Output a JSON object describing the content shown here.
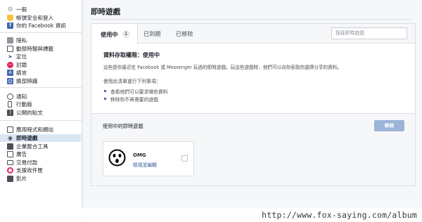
{
  "sidebar": {
    "groups": [
      {
        "items": [
          {
            "label": "一般",
            "icon": "gear-icon",
            "color": "#90949c"
          },
          {
            "label": "帳號安全和登入",
            "icon": "shield-icon",
            "color": "#f5c33b"
          },
          {
            "label": "你的 Facebook 資訊",
            "icon": "facebook-icon",
            "color": "#4267b2"
          }
        ]
      },
      {
        "items": [
          {
            "label": "隱私",
            "icon": "lock-icon",
            "color": "#90949c"
          },
          {
            "label": "動態時報與標籤",
            "icon": "timeline-icon",
            "color": "#4b4f56"
          },
          {
            "label": "定位",
            "icon": "location-icon",
            "color": "#4267b2"
          },
          {
            "label": "封鎖",
            "icon": "block-icon",
            "color": "#e0245e"
          },
          {
            "label": "語言",
            "icon": "language-icon",
            "color": "#4267b2"
          },
          {
            "label": "臉部辨識",
            "icon": "face-recognition-icon",
            "color": "#4267b2"
          }
        ]
      },
      {
        "items": [
          {
            "label": "通知",
            "icon": "globe-icon",
            "color": "#4b4f56"
          },
          {
            "label": "行動版",
            "icon": "mobile-icon",
            "color": "#4b4f56"
          },
          {
            "label": "公開的貼文",
            "icon": "rss-icon",
            "color": "#4b4f56"
          }
        ]
      },
      {
        "items": [
          {
            "label": "應用程式和網站",
            "icon": "apps-icon",
            "color": "#4b4f56"
          },
          {
            "label": "即時遊戲",
            "icon": "game-controller-icon",
            "color": "#4b4f56",
            "active": true
          },
          {
            "label": "企業整合工具",
            "icon": "business-icon",
            "color": "#4b4f56"
          },
          {
            "label": "廣告",
            "icon": "ads-icon",
            "color": "#4b4f56"
          },
          {
            "label": "交易付款",
            "icon": "payments-icon",
            "color": "#4b4f56"
          },
          {
            "label": "支援收件匣",
            "icon": "support-icon",
            "color": "#e0245e"
          },
          {
            "label": "影片",
            "icon": "video-icon",
            "color": "#4b4f56"
          }
        ]
      }
    ]
  },
  "main": {
    "title": "即時遊戲",
    "tabs": [
      {
        "label": "使用中",
        "count": "1"
      },
      {
        "label": "已到期"
      },
      {
        "label": "已移除"
      }
    ],
    "search_placeholder": "搜尋即時遊戲",
    "access_heading": "資料存取權限：使用中",
    "description": "這些是你最近在 Facebook 或 Messenger 玩過的即時遊戲。玩這些遊戲時，他們可以向你索取你選擇分享的資料。",
    "list_title": "使用此清單進行下列事項：",
    "bullets": [
      "查看他們可以要求哪些資料",
      "移除你不再需要的遊戲"
    ],
    "games_section_title": "使用中的即時遊戲",
    "remove_label": "移除",
    "game": {
      "name": "OMG",
      "link": "檢視並編輯",
      "icon": "surprised-face-icon"
    }
  },
  "watermark": "http://www.fox-saying.com/album",
  "colors": {
    "accent": "#4267b2",
    "link": "#365899",
    "disabled_button": "#9cb4d8",
    "active_item_bg": "#dbe6f5"
  }
}
